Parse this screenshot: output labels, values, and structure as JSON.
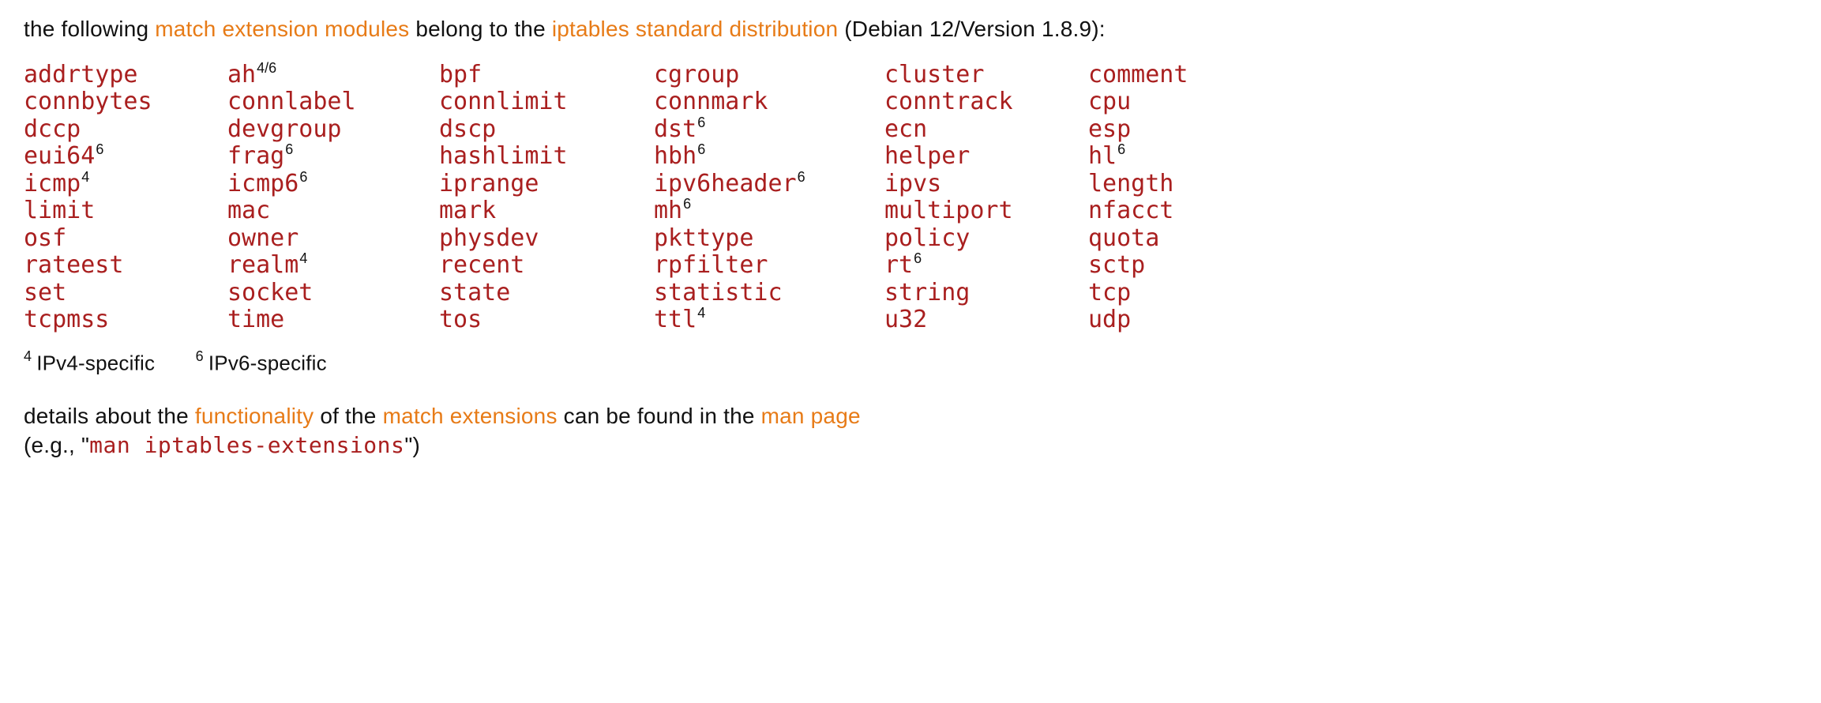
{
  "intro": {
    "prefix": "the following ",
    "link1": "match extension modules",
    "mid": " belong to the ",
    "link2": "iptables standard distribution",
    "suffix": " (Debian 12/Version 1.8.9):"
  },
  "modules": [
    {
      "name": "addrtype",
      "sup": ""
    },
    {
      "name": "ah",
      "sup": "4/6"
    },
    {
      "name": "bpf",
      "sup": ""
    },
    {
      "name": "cgroup",
      "sup": ""
    },
    {
      "name": "cluster",
      "sup": ""
    },
    {
      "name": "comment",
      "sup": ""
    },
    {
      "name": "connbytes",
      "sup": ""
    },
    {
      "name": "connlabel",
      "sup": ""
    },
    {
      "name": "connlimit",
      "sup": ""
    },
    {
      "name": "connmark",
      "sup": ""
    },
    {
      "name": "conntrack",
      "sup": ""
    },
    {
      "name": "cpu",
      "sup": ""
    },
    {
      "name": "dccp",
      "sup": ""
    },
    {
      "name": "devgroup",
      "sup": ""
    },
    {
      "name": "dscp",
      "sup": ""
    },
    {
      "name": "dst",
      "sup": "6"
    },
    {
      "name": "ecn",
      "sup": ""
    },
    {
      "name": "esp",
      "sup": ""
    },
    {
      "name": "eui64",
      "sup": "6"
    },
    {
      "name": "frag",
      "sup": "6"
    },
    {
      "name": "hashlimit",
      "sup": ""
    },
    {
      "name": "hbh",
      "sup": "6"
    },
    {
      "name": "helper",
      "sup": ""
    },
    {
      "name": "hl",
      "sup": "6"
    },
    {
      "name": "icmp",
      "sup": "4"
    },
    {
      "name": "icmp6",
      "sup": "6"
    },
    {
      "name": "iprange",
      "sup": ""
    },
    {
      "name": "ipv6header",
      "sup": "6"
    },
    {
      "name": "ipvs",
      "sup": ""
    },
    {
      "name": "length",
      "sup": ""
    },
    {
      "name": "limit",
      "sup": ""
    },
    {
      "name": "mac",
      "sup": ""
    },
    {
      "name": "mark",
      "sup": ""
    },
    {
      "name": "mh",
      "sup": "6"
    },
    {
      "name": "multiport",
      "sup": ""
    },
    {
      "name": "nfacct",
      "sup": ""
    },
    {
      "name": "osf",
      "sup": ""
    },
    {
      "name": "owner",
      "sup": ""
    },
    {
      "name": "physdev",
      "sup": ""
    },
    {
      "name": "pkttype",
      "sup": ""
    },
    {
      "name": "policy",
      "sup": ""
    },
    {
      "name": "quota",
      "sup": ""
    },
    {
      "name": "rateest",
      "sup": ""
    },
    {
      "name": "realm",
      "sup": "4"
    },
    {
      "name": "recent",
      "sup": ""
    },
    {
      "name": "rpfilter",
      "sup": ""
    },
    {
      "name": "rt",
      "sup": "6"
    },
    {
      "name": "sctp",
      "sup": ""
    },
    {
      "name": "set",
      "sup": ""
    },
    {
      "name": "socket",
      "sup": ""
    },
    {
      "name": "state",
      "sup": ""
    },
    {
      "name": "statistic",
      "sup": ""
    },
    {
      "name": "string",
      "sup": ""
    },
    {
      "name": "tcp",
      "sup": ""
    },
    {
      "name": "tcpmss",
      "sup": ""
    },
    {
      "name": "time",
      "sup": ""
    },
    {
      "name": "tos",
      "sup": ""
    },
    {
      "name": "ttl",
      "sup": "4"
    },
    {
      "name": "u32",
      "sup": ""
    },
    {
      "name": "udp",
      "sup": ""
    }
  ],
  "legend": {
    "ipv4": {
      "sup": "4",
      "text": "IPv4-specific"
    },
    "ipv6": {
      "sup": "6",
      "text": "IPv6-specific"
    }
  },
  "footer": {
    "prefix": "details about the ",
    "link1": "functionality",
    "mid1": " of the ",
    "link2": "match extensions",
    "mid2": " can be found in the ",
    "link3": "man page",
    "line2_prefix": "(e.g., \"",
    "man_cmd": "man  iptables-extensions",
    "line2_suffix": "\")"
  }
}
